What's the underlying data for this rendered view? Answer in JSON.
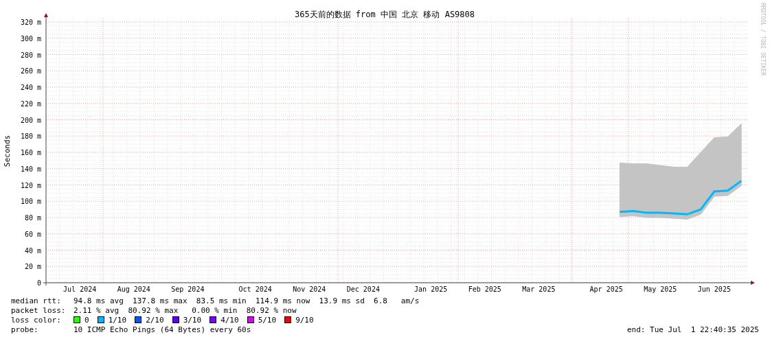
{
  "graph": {
    "title": "365天前的数据 from 中国 北京 移动 AS9808",
    "watermark": "RRDTOOL / TOBI OETIKER",
    "chart_data": {
      "type": "line",
      "grid": true,
      "ylabel": "Seconds",
      "ylim": [
        0,
        320
      ],
      "yticks": [
        {
          "value": 0,
          "label": "0"
        },
        {
          "value": 20,
          "label": "20 m"
        },
        {
          "value": 40,
          "label": "40 m"
        },
        {
          "value": 60,
          "label": "60 m"
        },
        {
          "value": 80,
          "label": "80 m"
        },
        {
          "value": 100,
          "label": "100 m"
        },
        {
          "value": 120,
          "label": "120 m"
        },
        {
          "value": 140,
          "label": "140 m"
        },
        {
          "value": 160,
          "label": "160 m"
        },
        {
          "value": 180,
          "label": "180 m"
        },
        {
          "value": 200,
          "label": "200 m"
        },
        {
          "value": 220,
          "label": "220 m"
        },
        {
          "value": 240,
          "label": "240 m"
        },
        {
          "value": 260,
          "label": "260 m"
        },
        {
          "value": 280,
          "label": "280 m"
        },
        {
          "value": 300,
          "label": "300 m"
        },
        {
          "value": 320,
          "label": "320 m"
        }
      ],
      "categories": [
        null,
        null,
        "Jul 2024",
        null,
        null,
        null,
        "Aug 2024",
        null,
        null,
        null,
        "Sep 2024",
        null,
        null,
        null,
        null,
        "Oct 2024",
        null,
        null,
        null,
        "Nov 2024",
        null,
        null,
        null,
        "Dec 2024",
        null,
        null,
        null,
        null,
        "Jan 2025",
        null,
        null,
        null,
        "Feb 2025",
        null,
        null,
        null,
        "Mar 2025",
        null,
        null,
        null,
        null,
        "Apr 2025",
        null,
        null,
        null,
        "May 2025",
        null,
        null,
        null,
        "Jun 2025",
        null,
        null
      ],
      "series": [
        {
          "type": "area",
          "color": "#c4c4c4",
          "values": [
            null,
            null,
            null,
            null,
            null,
            null,
            null,
            null,
            null,
            null,
            null,
            null,
            null,
            null,
            null,
            null,
            null,
            null,
            null,
            null,
            null,
            null,
            null,
            null,
            null,
            null,
            null,
            null,
            null,
            null,
            null,
            null,
            null,
            null,
            null,
            null,
            null,
            null,
            null,
            null,
            null,
            null,
            147,
            146,
            146,
            144,
            142,
            142,
            160,
            178,
            179,
            195
          ]
        },
        {
          "type": "line",
          "color": "#00b8ff",
          "values": [
            null,
            null,
            null,
            null,
            null,
            null,
            null,
            null,
            null,
            null,
            null,
            null,
            null,
            null,
            null,
            null,
            null,
            null,
            null,
            null,
            null,
            null,
            null,
            null,
            null,
            null,
            null,
            null,
            null,
            null,
            null,
            null,
            null,
            null,
            null,
            null,
            null,
            null,
            null,
            null,
            null,
            null,
            87,
            88,
            86,
            86,
            85,
            84,
            90,
            112,
            113,
            125
          ]
        }
      ]
    }
  },
  "legend": {
    "rows": [
      {
        "label": "median rtt:",
        "text": "94.8 ms avg  137.8 ms max  83.5 ms min  114.9 ms now  13.9 ms sd  6.8   am/s"
      },
      {
        "label": "packet loss:",
        "text": "2.11 % avg  80.92 % max   0.00 % min  80.92 % now"
      }
    ],
    "loss_color": {
      "label": "loss color:",
      "items": [
        {
          "text": "0",
          "color": "#26ff00"
        },
        {
          "text": "1/10",
          "color": "#00b8ff"
        },
        {
          "text": "2/10",
          "color": "#0059ff"
        },
        {
          "text": "3/10",
          "color": "#5e00ff"
        },
        {
          "text": "4/10",
          "color": "#7e00ff"
        },
        {
          "text": "5/10",
          "color": "#dd00ff"
        },
        {
          "text": "9/10",
          "color": "#ff0000"
        }
      ]
    },
    "probe": {
      "label": "probe:",
      "text": "10 ICMP Echo Pings (64 Bytes) every 60s"
    },
    "end": "end: Tue Jul  1 22:40:35 2025"
  }
}
